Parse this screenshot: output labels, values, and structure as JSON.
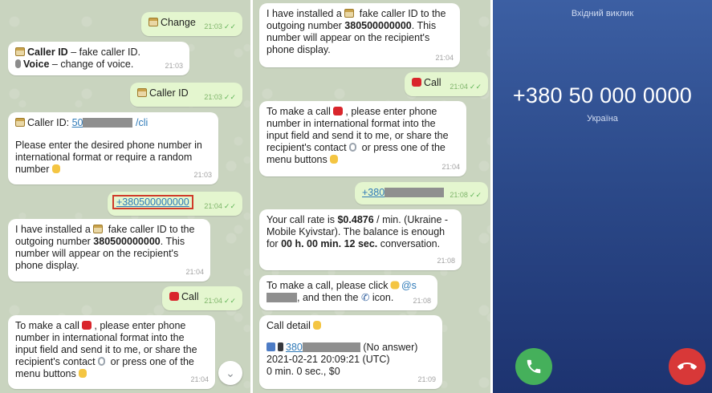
{
  "left_chat": {
    "messages": [
      {
        "id": "m1",
        "text": "Change",
        "time": "21:03"
      },
      {
        "id": "m2",
        "line1": "Caller ID",
        "line1_rest": " – fake caller ID.",
        "line2": "Voice",
        "line2_rest": " – change of voice.",
        "time": "21:03"
      },
      {
        "id": "m3",
        "text": "Caller ID",
        "time": "21:03"
      },
      {
        "id": "m4",
        "prefix": "Caller ID: ",
        "link": "50",
        "cmd": "/cli",
        "body": "Please enter the desired phone number in international format or require a random number",
        "time": "21:03"
      },
      {
        "id": "m5",
        "text": "+380500000000",
        "time": "21:04"
      },
      {
        "id": "m6",
        "a": "I have installed a ",
        "b": " fake caller ID to the outgoing number ",
        "num": "380500000000",
        "c": ". This number will appear on the recipient's phone display.",
        "time": "21:04"
      },
      {
        "id": "m7",
        "text": "Call",
        "time": "21:04"
      },
      {
        "id": "m8",
        "a": "To make a call ",
        "b": ", please enter phone number in international format into the input field and send it to me, or share the recipient's contact ",
        "c": " or press one of the menu buttons",
        "time": "21:04"
      }
    ]
  },
  "mid_chat": {
    "messages": [
      {
        "id": "n1",
        "a": "I have installed a ",
        "b": " fake caller ID to the outgoing number ",
        "num": "380500000000",
        "c": ". This number will appear on the recipient's phone display.",
        "time": "21:04"
      },
      {
        "id": "n2",
        "text": "Call",
        "time": "21:04"
      },
      {
        "id": "n3",
        "a": "To make a call ",
        "b": ", please enter phone number in international format into the input field and send it to me, or share the recipient's contact ",
        "c": " or press one of the menu buttons",
        "time": "21:04"
      },
      {
        "id": "n4",
        "text": "+380",
        "time": "21:08"
      },
      {
        "id": "n5",
        "a": "Your call rate is ",
        "rate": "$0.4876",
        "b": " / min. (Ukraine - Mobile Kyivstar). The balance is enough for ",
        "dur": "00 h. 00 min. 12 sec.",
        "c": " conversation.",
        "time": "21:08"
      },
      {
        "id": "n6",
        "a": "To make a call, please click ",
        "handle": "@s",
        "b": ", and then the ",
        "c": " icon.",
        "time": "21:08"
      },
      {
        "id": "n7",
        "title": "Call detail",
        "num": "380",
        "status": "(No answer)",
        "datetime": "2021-02-21 20:09:21 (UTC)",
        "summary": "0 min. 0 sec., $0",
        "time": "21:09"
      }
    ]
  },
  "call_screen": {
    "header": "Вхідний виклик",
    "number": "+380 50 000 0000",
    "country": "Україна"
  },
  "colors": {
    "outgoing": "#e4f6cf",
    "incoming": "#ffffff",
    "call_bg": "#2c4a8a",
    "accept": "#45b05b",
    "decline": "#d83838",
    "highlight": "#d03b2a"
  }
}
